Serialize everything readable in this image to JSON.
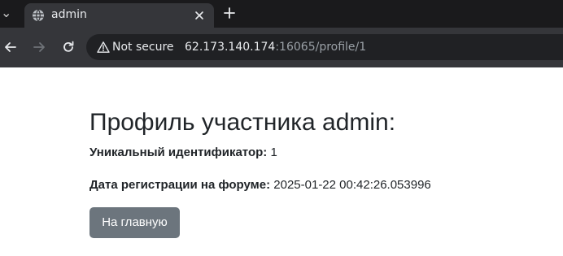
{
  "browser": {
    "tab_title": "admin",
    "security_label": "Not secure",
    "url_host": "62.173.140.174",
    "url_rest": ":16065/profile/1"
  },
  "profile": {
    "heading": "Профиль участника admin:",
    "id_label": "Уникальный идентификатор:",
    "id_value": "1",
    "date_label": "Дата регистрации на форуме:",
    "date_value": "2025-01-22 00:42:26.053996",
    "home_button": "На главную"
  },
  "colors": {
    "tabstrip_bg": "#1a1a1c",
    "toolbar_bg": "#35363a",
    "omnibox_bg": "#202124",
    "button_bg": "#6c757d",
    "text": "#212529"
  },
  "icons": [
    "chevron-down-icon",
    "globe-icon",
    "close-icon",
    "plus-icon",
    "back-arrow-icon",
    "forward-arrow-icon",
    "reload-icon",
    "warning-icon"
  ]
}
